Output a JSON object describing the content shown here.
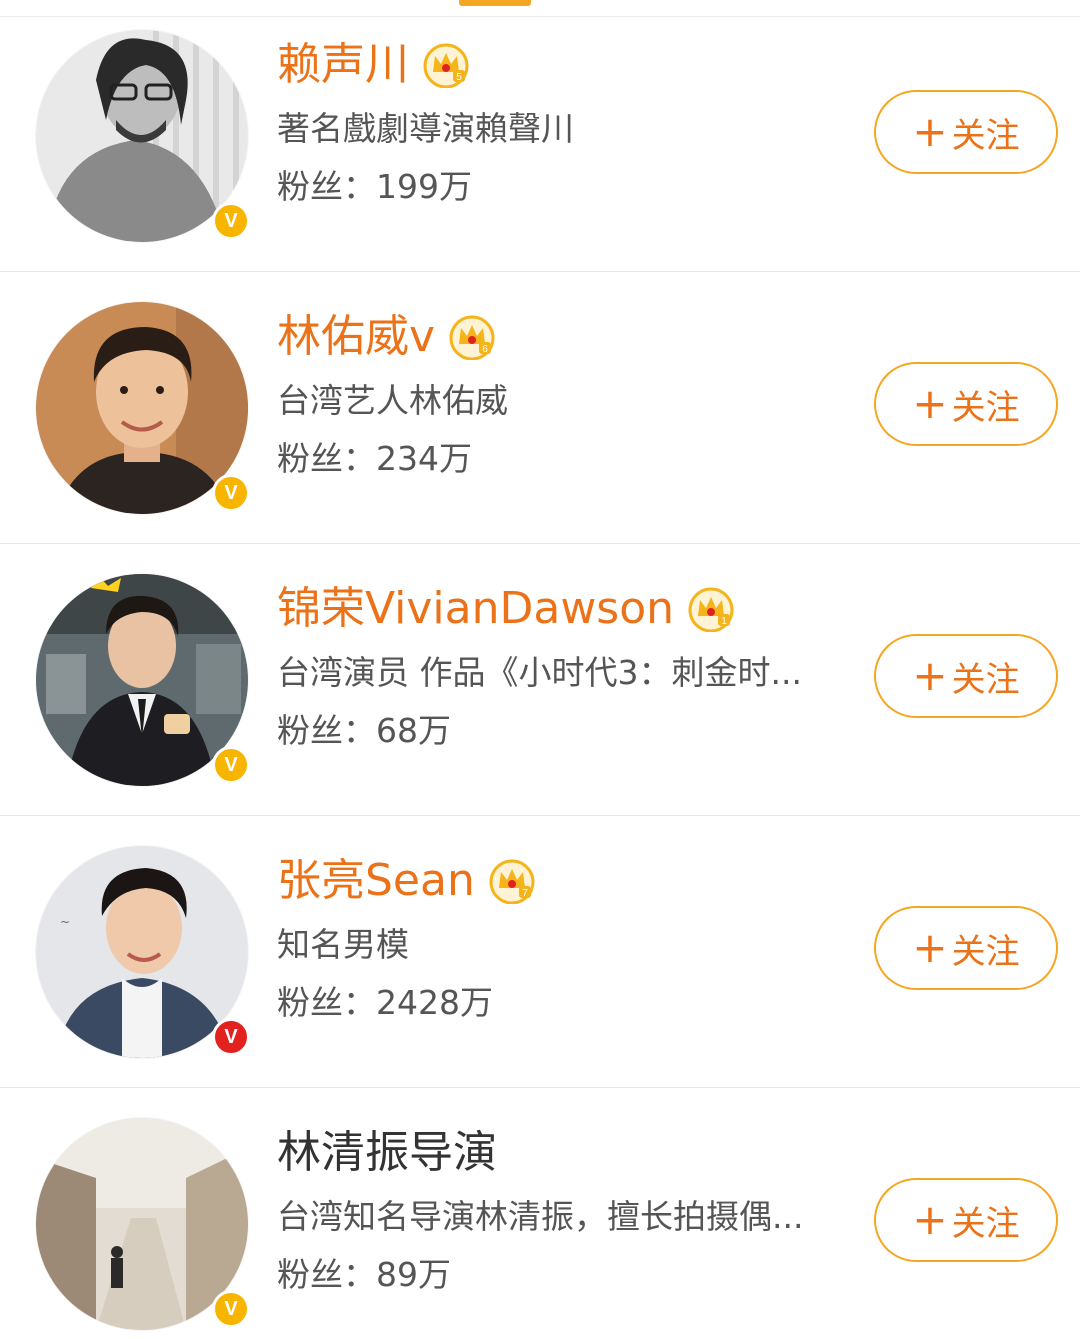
{
  "colors": {
    "accent": "#eb7219",
    "button_border": "#f5a623",
    "badge_yellow": "#f7b500",
    "badge_red": "#e2221f",
    "crown_gold": "#f5b41a",
    "divider": "#e6e6e6"
  },
  "fans_label": "粉丝：",
  "follow_plus": "+",
  "follow_label": "关注",
  "users": [
    {
      "name": "赖声川",
      "crown_level": "5",
      "description": "著名戲劇導演賴聲川",
      "fans": "199万",
      "verified_badge": "yellow",
      "avatar": "bw-portrait"
    },
    {
      "name": "林佑威v",
      "crown_level": "6",
      "description": "台湾艺人林佑威",
      "fans": "234万",
      "verified_badge": "yellow",
      "avatar": "portrait"
    },
    {
      "name": "锦荣VivianDawson",
      "crown_level": "1",
      "description": "台湾演员 作品《小时代3：刺金时...",
      "fans": "68万",
      "verified_badge": "yellow",
      "avatar": "suit-portrait"
    },
    {
      "name": "张亮Sean",
      "crown_level": "7",
      "description": "知名男模",
      "fans": "2428万",
      "verified_badge": "red",
      "avatar": "portrait"
    },
    {
      "name": "林清振导演",
      "crown_level": "",
      "description": "台湾知名导演林清振，擅长拍摄偶...",
      "fans": "89万",
      "verified_badge": "yellow",
      "avatar": "street-scene"
    }
  ]
}
